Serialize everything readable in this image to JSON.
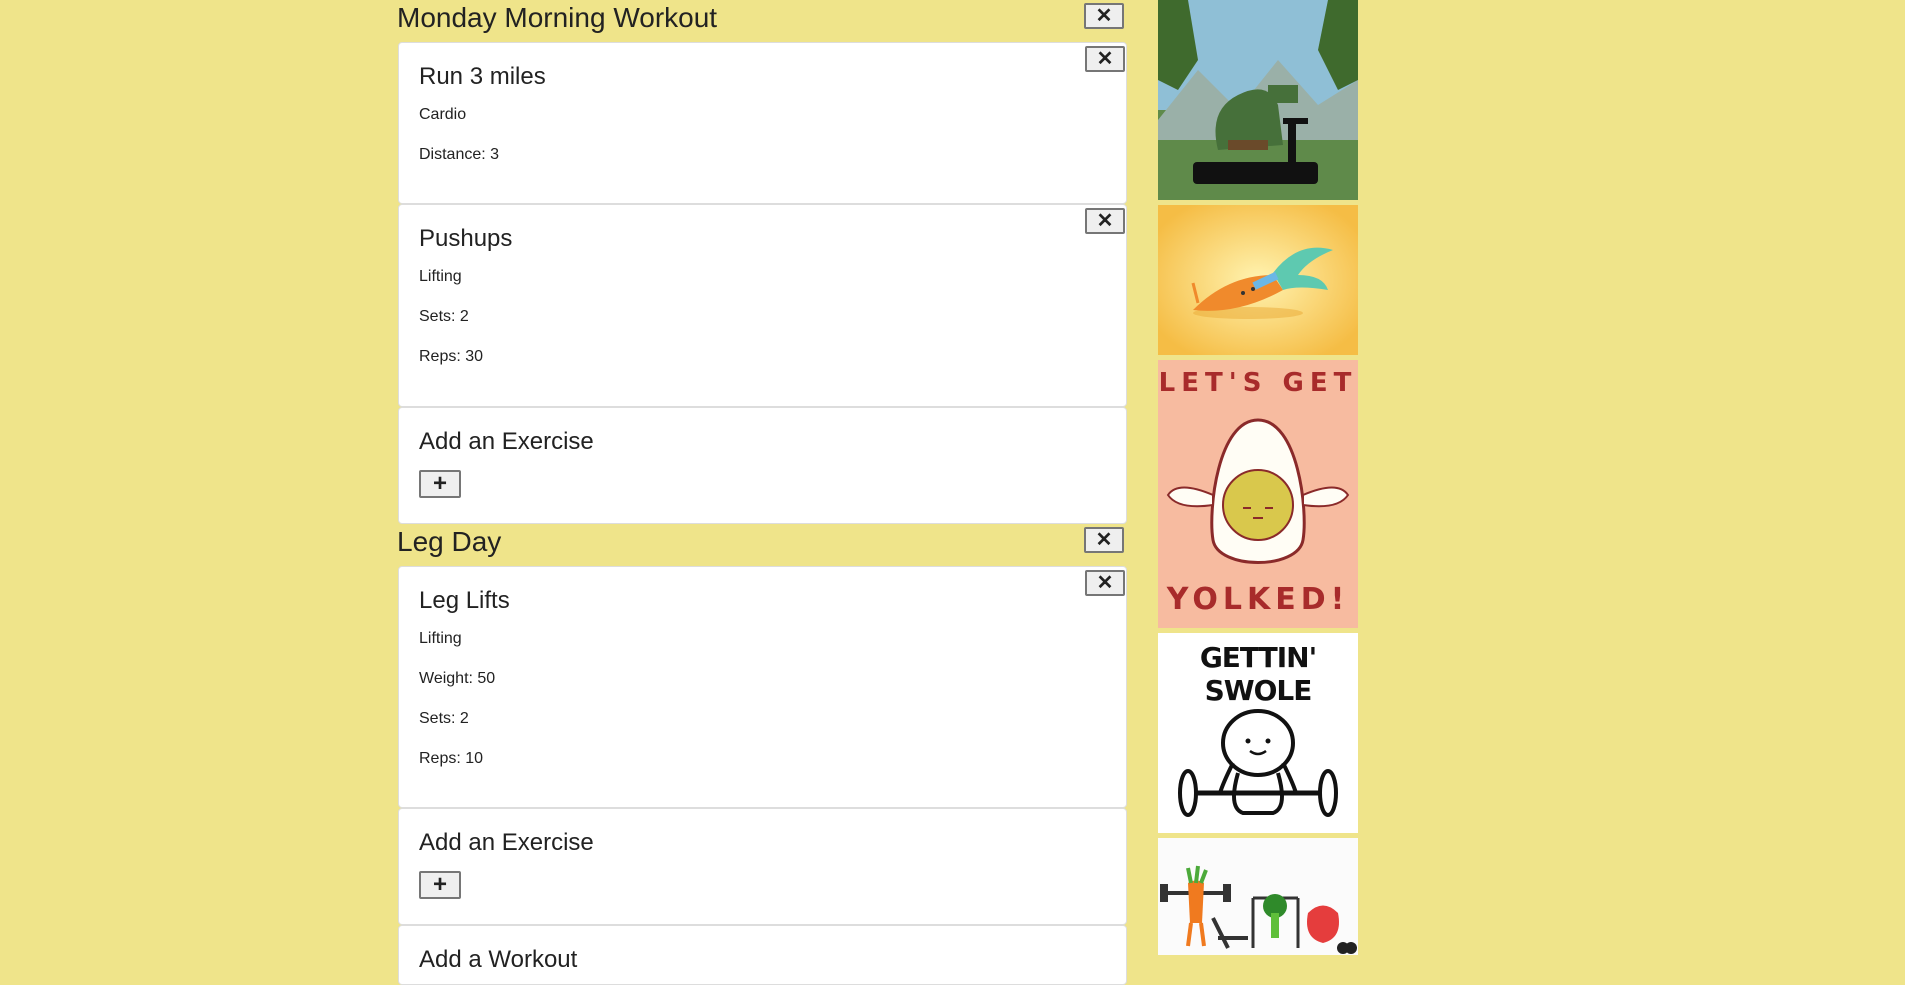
{
  "workouts": [
    {
      "title": "Monday Morning Workout",
      "exercises": [
        {
          "name": "Run 3 miles",
          "type": "Cardio",
          "details": [
            "Distance: 3"
          ]
        },
        {
          "name": "Pushups",
          "type": "Lifting",
          "details": [
            "Sets: 2",
            "Reps: 30"
          ]
        }
      ],
      "add_exercise": {
        "heading": "Add an Exercise",
        "button": "+"
      }
    },
    {
      "title": "Leg Day",
      "exercises": [
        {
          "name": "Leg Lifts",
          "type": "Lifting",
          "details": [
            "Weight: 50",
            "Sets: 2",
            "Reps: 10"
          ]
        }
      ],
      "add_exercise": {
        "heading": "Add an Exercise",
        "button": "+"
      }
    }
  ],
  "add_workout": {
    "heading": "Add a Workout"
  },
  "close_label": "✕",
  "sidebar": {
    "gifs": [
      {
        "name": "dinosaur-treadmill-gif"
      },
      {
        "name": "carrot-stretching-gif"
      },
      {
        "name": "lets-get-yolked-egg-gif",
        "text_top": "LET'S GET",
        "text_bottom": "YOLKED!"
      },
      {
        "name": "gettin-swole-gif",
        "text": "GETTIN' SWOLE"
      },
      {
        "name": "veggies-gym-gif"
      }
    ]
  },
  "colors": {
    "background": "#efe48a",
    "card": "#ffffff",
    "button": "#efefef"
  }
}
